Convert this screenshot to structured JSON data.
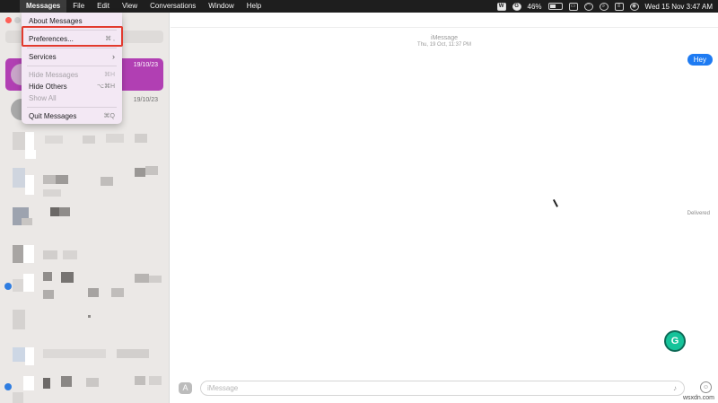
{
  "menubar": {
    "app_menu": "Messages",
    "menus": [
      "File",
      "Edit",
      "View",
      "Conversations",
      "Window",
      "Help"
    ],
    "battery_percent": "46%",
    "clock": "Wed 15 Nov  3:47 AM"
  },
  "app_menu_dropdown": {
    "items": [
      {
        "label": "About Messages",
        "shortcut": "",
        "enabled": true
      },
      {
        "label": "Preferences...",
        "shortcut": "⌘ ,",
        "enabled": true,
        "highlighted": true
      },
      {
        "label": "Services",
        "shortcut": "",
        "enabled": true,
        "submenu": true
      },
      {
        "label": "Hide Messages",
        "shortcut": "⌘H",
        "enabled": false
      },
      {
        "label": "Hide Others",
        "shortcut": "⌥⌘H",
        "enabled": true
      },
      {
        "label": "Show All",
        "shortcut": "",
        "enabled": false
      },
      {
        "label": "Quit Messages",
        "shortcut": "⌘Q",
        "enabled": true
      }
    ]
  },
  "sidebar": {
    "conversations": [
      {
        "date": "19/10/23",
        "selected": true
      },
      {
        "date": "19/10/23",
        "selected": false
      }
    ]
  },
  "conversation": {
    "service": "iMessage",
    "timestamp": "Thu, 19 Oct, 11:37 PM",
    "messages": [
      {
        "text": "Hey",
        "from_me": true
      }
    ],
    "delivered_label": "Delivered",
    "input_placeholder": "iMessage"
  },
  "grammarly_label": "G",
  "watermark": "wsxdn.com",
  "colors": {
    "selection": "#b13fb3",
    "bubble": "#1e7bf2",
    "highlight_box": "#e23a2e",
    "unread_dot": "#2f7de1"
  }
}
